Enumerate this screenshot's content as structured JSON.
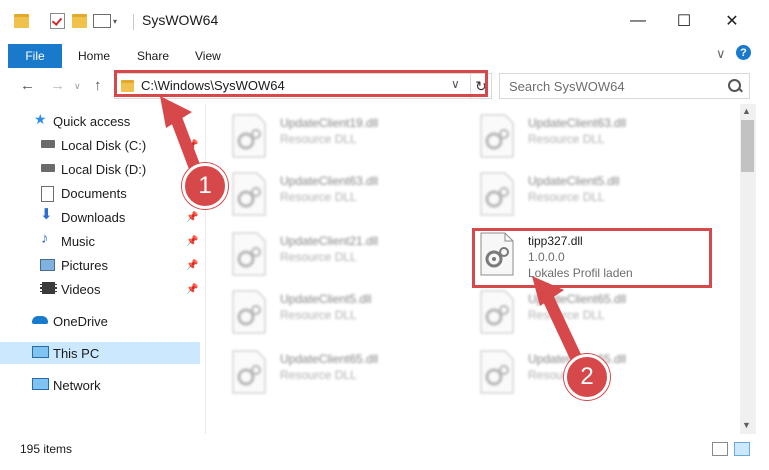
{
  "window": {
    "title": "SysWOW64",
    "controls": {
      "minimize": "—",
      "maximize": "☐",
      "close": "✕"
    }
  },
  "ribbon": {
    "tabs": [
      "File",
      "Home",
      "Share",
      "View"
    ],
    "expand_icon": "∨",
    "help_icon": "?"
  },
  "nav": {
    "back": "←",
    "forward": "→",
    "up": "↑",
    "address": "C:\\Windows\\SysWOW64",
    "dropdown": "∨",
    "refresh": "↻",
    "search_placeholder": "Search SysWOW64"
  },
  "sidebar": {
    "items": [
      {
        "label": "Quick access",
        "icon": "star-icon"
      },
      {
        "label": "Local Disk (C:)",
        "icon": "drive-icon"
      },
      {
        "label": "Local Disk (D:)",
        "icon": "drive-icon"
      },
      {
        "label": "Documents",
        "icon": "documents-icon"
      },
      {
        "label": "Downloads",
        "icon": "download-icon"
      },
      {
        "label": "Music",
        "icon": "music-icon"
      },
      {
        "label": "Pictures",
        "icon": "pictures-icon"
      },
      {
        "label": "Videos",
        "icon": "videos-icon"
      },
      {
        "label": "OneDrive",
        "icon": "cloud-icon"
      },
      {
        "label": "This PC",
        "icon": "computer-icon"
      },
      {
        "label": "Network",
        "icon": "network-icon"
      }
    ]
  },
  "files": [
    {
      "name": "UpdateClient19.dll",
      "type": "Resource DLL"
    },
    {
      "name": "UpdateClient63.dll",
      "type": "Resource DLL"
    },
    {
      "name": "UpdateClient63.dll",
      "type": "Resource DLL"
    },
    {
      "name": "UpdateClient5.dll",
      "type": "Resource DLL"
    },
    {
      "name": "UpdateClient21.dll",
      "type": "Resource DLL"
    },
    {
      "name": "tipp327.dll",
      "version": "1.0.0.0",
      "description": "Lokales Profil laden"
    },
    {
      "name": "UpdateClient5.dll",
      "type": "Resource DLL"
    },
    {
      "name": "UpdateClient65.dll",
      "type": "Resource DLL"
    },
    {
      "name": "UpdateClient65.dll",
      "type": "Resource DLL"
    },
    {
      "name": "UpdateClient65.dll",
      "type": "Resource DLL"
    }
  ],
  "annotations": {
    "step1": "1",
    "step2": "2"
  },
  "status": {
    "items": "195 items"
  },
  "colors": {
    "accent": "#1979ca",
    "highlight": "#d6484a",
    "selected": "#cce8ff"
  }
}
